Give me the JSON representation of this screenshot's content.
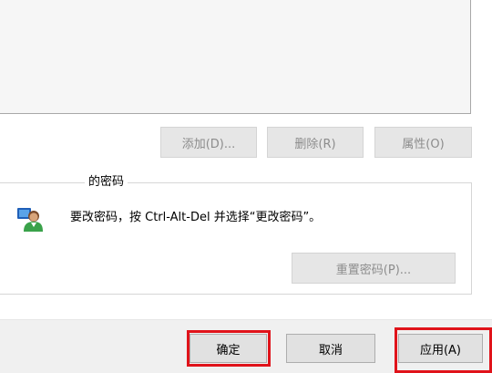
{
  "list_buttons": {
    "add_label": "添加(D)...",
    "remove_label": "删除(R)",
    "properties_label": "属性(O)"
  },
  "password_group": {
    "title": "的密码",
    "info_text": "要改密码，按 Ctrl-Alt-Del 并选择“更改密码”。",
    "reset_label": "重置密码(P)..."
  },
  "dialog_buttons": {
    "ok_label": "确定",
    "cancel_label": "取消",
    "apply_label": "应用(A)"
  },
  "colors": {
    "highlight": "#e0131a",
    "panel_bg": "#f6f6f6",
    "button_bg": "#e1e1e1",
    "disabled_text": "#8c8c8c"
  },
  "icons": {
    "user": "user-icon"
  }
}
